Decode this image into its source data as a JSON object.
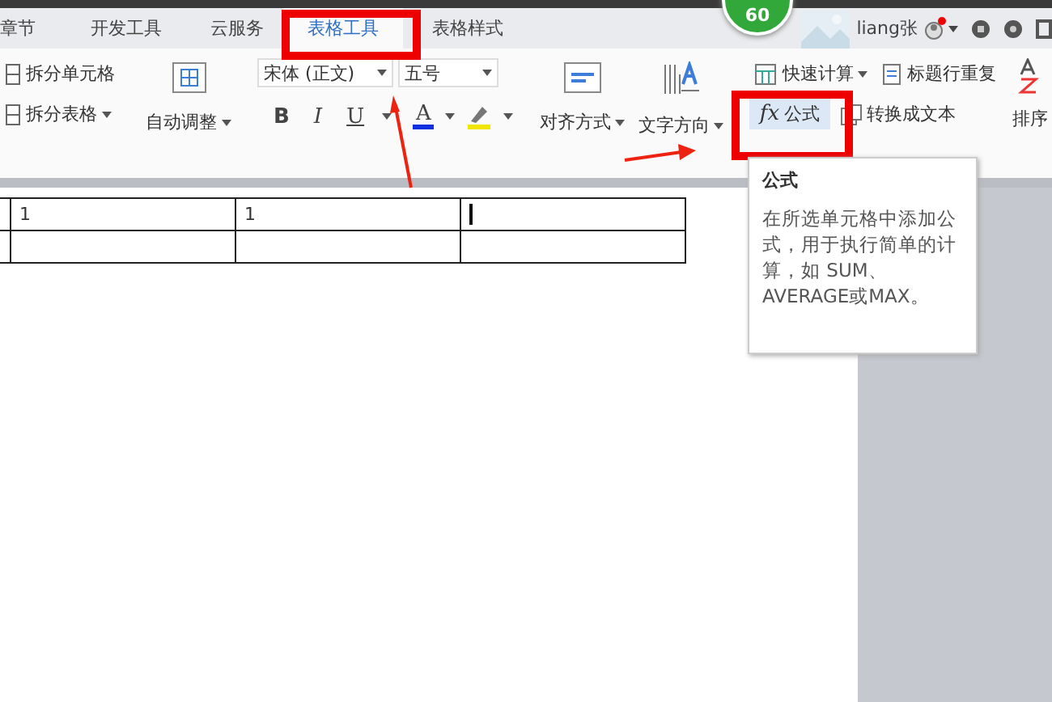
{
  "tabs": [
    {
      "label": "章节",
      "selected": false
    },
    {
      "label": "开发工具",
      "selected": false
    },
    {
      "label": "云服务",
      "selected": false
    },
    {
      "label": "表格工具",
      "selected": true
    },
    {
      "label": "表格样式",
      "selected": false
    }
  ],
  "badge": "60",
  "user": {
    "name": "liang张",
    "notification": true
  },
  "ribbon": {
    "split": [
      "拆分单元格",
      "拆分表格"
    ],
    "autofit": "自动调整",
    "font": "宋体 (正文)",
    "size": "五号",
    "format": [
      "B",
      "I",
      "U",
      "A"
    ],
    "align": "对齐方式",
    "direction": "文字方向",
    "quick_calc": "快速计算",
    "repeat_header": "标题行重复",
    "formula_icon": "fx",
    "formula": "公式",
    "convert": "转换成文本",
    "sort": "排序"
  },
  "table": {
    "rows": [
      [
        "",
        "1",
        "1",
        ""
      ],
      [
        "",
        "",
        "",
        ""
      ]
    ]
  },
  "tooltip": {
    "title": "公式",
    "body": "在所选单元格中添加公式，用于执行简单的计算，如 SUM、AVERAGE或MAX。"
  }
}
